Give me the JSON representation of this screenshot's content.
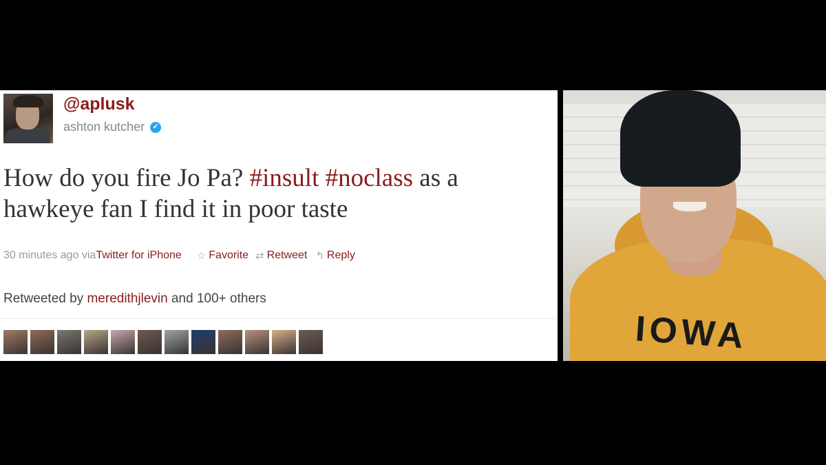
{
  "tweet": {
    "handle": "@aplusk",
    "name": "ashton kutcher",
    "verified_mark": "✓",
    "text_parts": {
      "p1": "How do you fire Jo Pa? ",
      "h1": "#insult",
      "sp": " ",
      "h2": "#noclass",
      "p2": " as a hawkeye fan I find it in poor taste"
    },
    "timestamp": "30 minutes ago via ",
    "source": "Twitter for iPhone",
    "actions": {
      "favorite": "Favorite",
      "favorite_icon": "☆",
      "retweet": "Retweet",
      "retweet_icon": "⇄",
      "reply": "Reply",
      "reply_icon": "↰"
    },
    "retweeted_by_label": "Retweeted by ",
    "retweeted_by_user": "meredithjlevin",
    "retweeted_by_rest": " and 100+ others"
  },
  "colors": {
    "accent": "#8a1c1c",
    "verified": "#2aa3ef",
    "background": "#000000"
  },
  "retweeter_avatar_colors": [
    "#a07a66",
    "#8f6a55",
    "#7a7670",
    "#b7a48a",
    "#c9a6b0",
    "#6d5a4e",
    "#9aa5a8",
    "#1f3d6e",
    "#8c6b5b",
    "#b98f82",
    "#d7b08a",
    "#6b5b52"
  ],
  "photo": {
    "shirt_text": "IOWA"
  }
}
